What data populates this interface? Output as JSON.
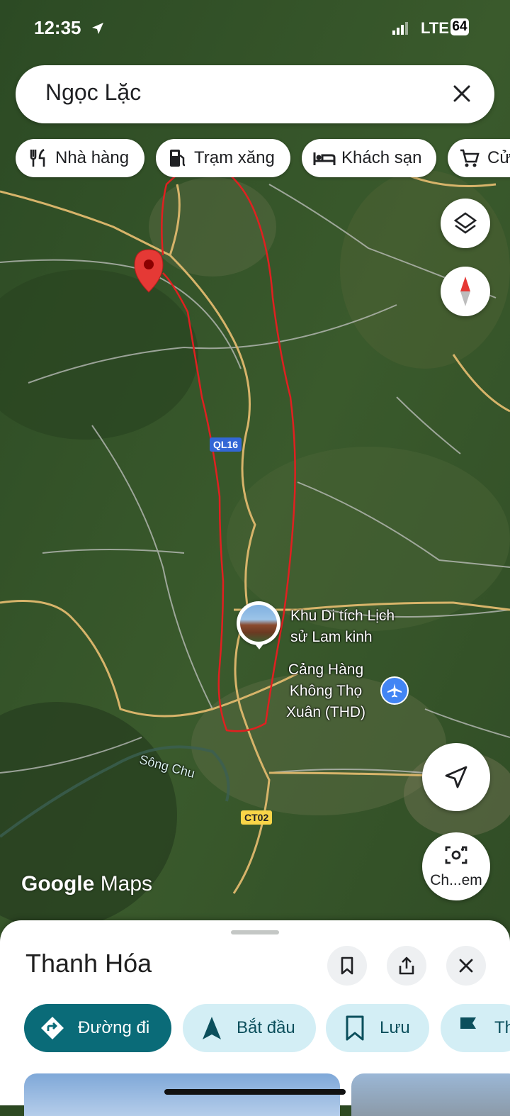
{
  "status": {
    "time": "12:35",
    "network": "LTE",
    "battery": "64"
  },
  "search": {
    "query": "Ngọc Lặc"
  },
  "chips": [
    {
      "label": "Nhà hàng",
      "icon": "fork-knife-icon"
    },
    {
      "label": "Trạm xăng",
      "icon": "gas-station-icon"
    },
    {
      "label": "Khách sạn",
      "icon": "bed-icon"
    },
    {
      "label": "Cử",
      "icon": "cart-icon"
    }
  ],
  "map": {
    "road_labels": [
      "QL16",
      "CT02"
    ],
    "river_label": "Sông Chu",
    "poi_1": {
      "line1": "Khu Di tích Lịch",
      "line2": "sử Lam kinh"
    },
    "poi_2": {
      "line1": "Cảng Hàng",
      "line2": "Không Thọ",
      "line3": "Xuân (THD)"
    },
    "logo_google": "Google",
    "logo_maps": "Maps",
    "camera_label": "Ch...em",
    "annotation_color": "#e02020",
    "pin_color": "#e53935"
  },
  "sheet": {
    "title": "Thanh Hóa",
    "actions": [
      {
        "label": "Đường đi",
        "icon": "directions-icon"
      },
      {
        "label": "Bắt đầu",
        "icon": "navigation-arrow-icon"
      },
      {
        "label": "Lưu",
        "icon": "bookmark-icon"
      },
      {
        "label": "Th",
        "icon": "flag-icon"
      }
    ]
  },
  "colors": {
    "primary": "#0a6b78",
    "chip_bg": "#d3eef5"
  }
}
